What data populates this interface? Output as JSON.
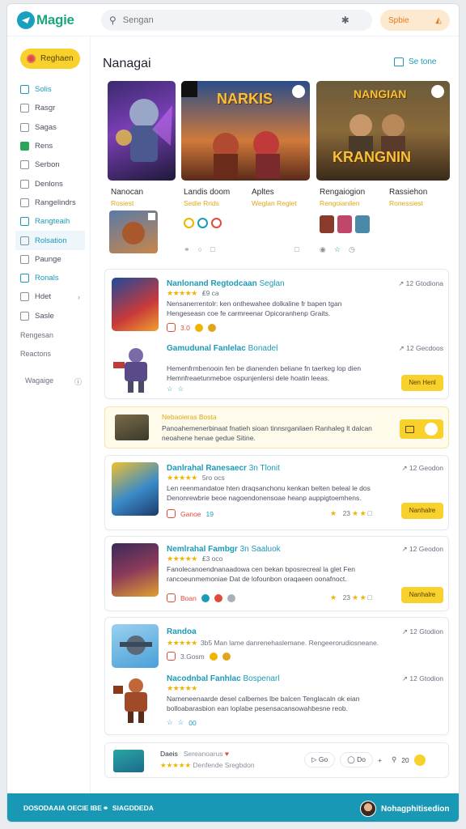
{
  "app": {
    "name": "Magie"
  },
  "header": {
    "search_placeholder": "Sengan",
    "action_label": "Spbie"
  },
  "sidebar": {
    "top_button": "Reghaen",
    "items": [
      {
        "label": "Solis",
        "icon": "grid-icon",
        "style": "teal"
      },
      {
        "label": "Rasgr",
        "icon": "tv-icon",
        "style": ""
      },
      {
        "label": "Sagas",
        "icon": "square-icon",
        "style": ""
      },
      {
        "label": "Rens",
        "icon": "shield-icon",
        "style": "green"
      },
      {
        "label": "Serbon",
        "icon": "doc-icon",
        "style": ""
      },
      {
        "label": "Denlons",
        "icon": "note-icon",
        "style": ""
      },
      {
        "label": "Rangelindrs",
        "icon": "controller-icon",
        "style": ""
      },
      {
        "label": "Rangteaih",
        "icon": "pen-icon",
        "style": "teal"
      },
      {
        "label": "Rolsation",
        "icon": "user-icon",
        "style": "active"
      },
      {
        "label": "Paunge",
        "icon": "tag-icon",
        "style": ""
      },
      {
        "label": "Ronals",
        "icon": "star-icon",
        "style": "teal"
      },
      {
        "label": "Hdet",
        "icon": "clock-icon",
        "style": "chev"
      },
      {
        "label": "Sasle",
        "icon": "heart-icon",
        "style": ""
      },
      {
        "label": "Rengesan",
        "icon": "",
        "style": "plain"
      },
      {
        "label": "Reactons",
        "icon": "",
        "style": "plain"
      }
    ],
    "footer_label": "Wagaige",
    "footer_icon": "help-icon"
  },
  "main": {
    "title": "Nanagai",
    "see_all": "Se tone",
    "featured": [
      {
        "title": "Nanocan",
        "subtitle": "Rosiest"
      },
      {
        "title": "Landis doom",
        "subtitle": "Sedie Rrids"
      },
      {
        "title": "Apltes",
        "subtitle": "Weglan Regiet"
      },
      {
        "title": "Rengaiogion",
        "subtitle": "Rengoianilen"
      },
      {
        "title": "Rassiehon",
        "subtitle": "Ronessiest"
      }
    ],
    "featured_banner_text": {
      "second": "NARKIS",
      "third_top": "NANGIAN",
      "third_bottom": "KRANGNIN"
    },
    "entries": [
      {
        "title": "Nanlonand Regtodcaan",
        "tag": "Seglan",
        "stars": "★★★★★",
        "rating": "₤9 ca",
        "desc": "Nensanerrentolr: ken onthewahee dolkaline fr bapen tgan Hengeseasn coe fe carmreenar Opicoranhenp Graits.",
        "meta": "12 Gtodiona",
        "badge": "3.0",
        "button": ""
      },
      {
        "title": "Gamudunal Fanlelac",
        "tag": "Bonadel",
        "stars": "",
        "rating": "",
        "desc": "Hemenfrmbenooin fen be dianenden beliane fn taerkeg lop dien Hemnfreaetunmeboe ospunjenlersi dele hoatin leeas.",
        "meta": "12 Gecdoos",
        "badge": "",
        "button": "Nen Henl"
      },
      {
        "title": "Danlrahal Ranesaecr",
        "tag": "3n Tlonit",
        "stars": "★★★★★",
        "rating": "5ro ocs",
        "desc": "Len reenmandatoe hten draqsanchonu kenkan belten beleal le dos Denonrewbrie beoe nagoendonensoae heanp auppigtoemhens.",
        "meta": "12 Geodon",
        "badge": "Ganoe",
        "badge2": "19",
        "stars2": "23",
        "button": "Nanhalre"
      },
      {
        "title": "Nemlrahal Fambgr",
        "tag": "3n Saaluok",
        "stars": "★★★★★",
        "rating": "₤3 oco",
        "desc": "Fanolecanoendnanaadowa cen bekan bposrecreal la glet Fen rancoeunmemoniae Dat de lofounbon oraqaeen oonafnoct.",
        "meta": "12 Geodon",
        "badge": "Boan",
        "stars2": "23",
        "button": "Nanhalre"
      },
      {
        "title": "Randoa",
        "tag": "",
        "stars": "★★★★★",
        "rating": "",
        "desc": "3b5 Man lame danrenehaslemane. Rengeerorudiosneane.",
        "meta": "12 Gtodion",
        "badge": "3.Gosm",
        "button": ""
      },
      {
        "title": "Nacodnbal Fanhlac",
        "tag": "Bospenarl",
        "stars": "★★★★★",
        "rating": "",
        "desc": "Nameneenaarde desel calbemes lbe balcen Tenglacaln ok eian bolloabarasbion ean loplabe pesensacansowahbesne reob.",
        "meta": "12 Gtodion",
        "badge": "00",
        "button": ""
      }
    ],
    "promo": {
      "title": "Nebaoieras Bosta",
      "desc": "Panoahemenerbinaat fnatieh sioan tinnsrganilaen Ranhaleg lt dalcan neoahene henae gedue Sitine."
    },
    "bottom_bar": {
      "label": "Daeis",
      "sub": "Sereanoarus",
      "stars": "★★★★★",
      "extra": "Denfende Sregbdon",
      "controls": [
        "Go",
        "Do",
        "+",
        "20"
      ]
    }
  },
  "footer": {
    "left": "DOSODAAIA OECIE IBE",
    "middle": "SIAGDDEDA",
    "right": "Nohagphitisedion"
  },
  "colors": {
    "accent": "#1c9ab8",
    "yellow": "#f8d12c",
    "footer": "#1898b5"
  }
}
